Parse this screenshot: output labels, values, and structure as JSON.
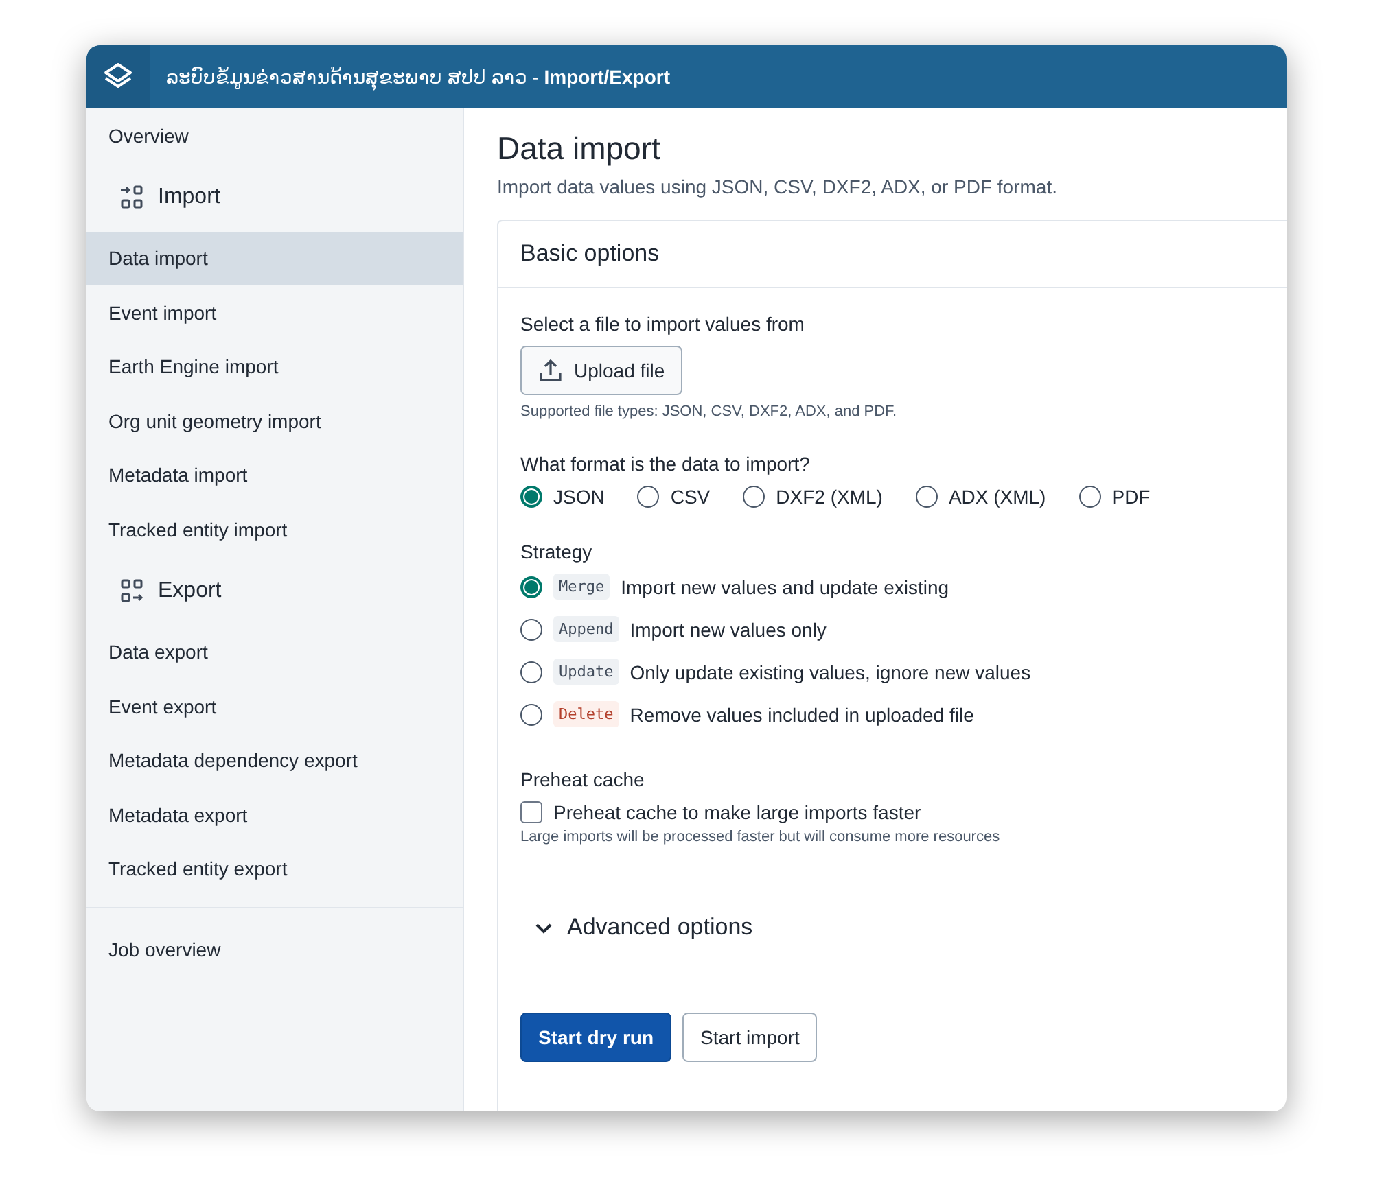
{
  "header": {
    "title_prefix": "ລະບົບຂໍ້ມູນຂ່າວສານດ້ານສຸຂະພາບ ສປປ ລາວ - ",
    "title_app": "Import/Export"
  },
  "sidebar": {
    "items": [
      {
        "kind": "link",
        "label": "Overview",
        "selected": false
      },
      {
        "kind": "section",
        "label": "Import"
      },
      {
        "kind": "link",
        "label": "Data import",
        "selected": true
      },
      {
        "kind": "link",
        "label": "Event import",
        "selected": false
      },
      {
        "kind": "link",
        "label": "Earth Engine import",
        "selected": false
      },
      {
        "kind": "link",
        "label": "Org unit geometry import",
        "selected": false
      },
      {
        "kind": "link",
        "label": "Metadata import",
        "selected": false
      },
      {
        "kind": "link",
        "label": "Tracked entity import",
        "selected": false
      },
      {
        "kind": "section",
        "label": "Export"
      },
      {
        "kind": "link",
        "label": "Data export",
        "selected": false
      },
      {
        "kind": "link",
        "label": "Event export",
        "selected": false
      },
      {
        "kind": "link",
        "label": "Metadata dependency export",
        "selected": false
      },
      {
        "kind": "link",
        "label": "Metadata export",
        "selected": false
      },
      {
        "kind": "link",
        "label": "Tracked entity export",
        "selected": false
      },
      {
        "kind": "divider"
      },
      {
        "kind": "link",
        "label": "Job overview",
        "selected": false
      }
    ]
  },
  "page": {
    "title": "Data import",
    "subtitle": "Import data values using JSON, CSV, DXF2, ADX, or PDF format."
  },
  "card": {
    "title": "Basic options",
    "file": {
      "label": "Select a file to import values from",
      "button": "Upload file",
      "help": "Supported file types: JSON, CSV, DXF2, ADX, and PDF."
    },
    "format": {
      "label": "What format is the data to import?",
      "options": [
        {
          "label": "JSON",
          "selected": true
        },
        {
          "label": "CSV",
          "selected": false
        },
        {
          "label": "DXF2 (XML)",
          "selected": false
        },
        {
          "label": "ADX (XML)",
          "selected": false
        },
        {
          "label": "PDF",
          "selected": false
        }
      ]
    },
    "strategy": {
      "label": "Strategy",
      "options": [
        {
          "code": "Merge",
          "kind": "neutral",
          "label": "Import new values and update existing",
          "selected": true
        },
        {
          "code": "Append",
          "kind": "neutral",
          "label": "Import new values only",
          "selected": false
        },
        {
          "code": "Update",
          "kind": "neutral",
          "label": "Only update existing values, ignore new values",
          "selected": false
        },
        {
          "code": "Delete",
          "kind": "danger",
          "label": "Remove values included in uploaded file",
          "selected": false
        }
      ]
    },
    "preheat": {
      "label": "Preheat cache",
      "checkbox": "Preheat cache to make large imports faster",
      "checked": false,
      "help": "Large imports will be processed faster but will consume more resources"
    },
    "advanced": {
      "label": "Advanced options",
      "expanded": false
    }
  },
  "actions": [
    {
      "label": "Start dry run",
      "kind": "primary"
    },
    {
      "label": "Start import",
      "kind": "secondary"
    }
  ]
}
